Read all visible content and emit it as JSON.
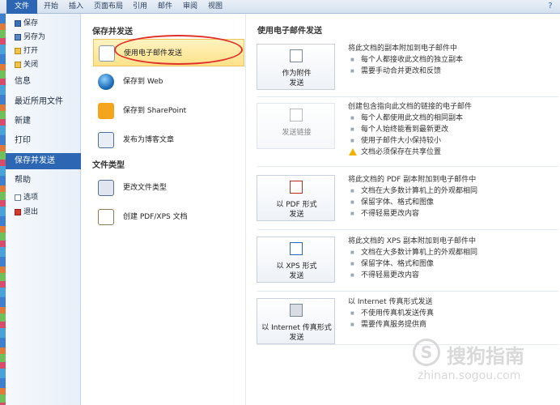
{
  "tabs": [
    "文件",
    "开始",
    "插入",
    "页面布局",
    "引用",
    "邮件",
    "审阅",
    "视图"
  ],
  "window_help": "?",
  "left_menu": {
    "items": [
      {
        "label": "保存",
        "icon": "save-icon"
      },
      {
        "label": "另存为",
        "icon": "save-as-icon"
      },
      {
        "label": "打开",
        "icon": "open-folder-icon"
      },
      {
        "label": "关闭",
        "icon": "close-document-icon"
      }
    ],
    "sections": [
      "信息",
      "最近所用文件",
      "新建",
      "打印",
      "保存并发送",
      "帮助"
    ],
    "active_section": "保存并发送",
    "bottom_items": [
      {
        "label": "选项",
        "icon": "options-icon"
      },
      {
        "label": "退出",
        "icon": "exit-icon"
      }
    ]
  },
  "middle": {
    "section1_title": "保存并发送",
    "options1": [
      {
        "label": "使用电子邮件发送",
        "icon": "email-icon",
        "selected": true
      },
      {
        "label": "保存到 Web",
        "icon": "globe-icon",
        "selected": false
      },
      {
        "label": "保存到 SharePoint",
        "icon": "sharepoint-icon",
        "selected": false
      },
      {
        "label": "发布为博客文章",
        "icon": "blog-icon",
        "selected": false
      }
    ],
    "section2_title": "文件类型",
    "options2": [
      {
        "label": "更改文件类型",
        "icon": "change-filetype-icon"
      },
      {
        "label": "创建 PDF/XPS 文档",
        "icon": "pdf-xps-icon"
      }
    ]
  },
  "right": {
    "title": "使用电子邮件发送",
    "actions": [
      {
        "button": [
          "作为附件",
          "发送"
        ],
        "icon": "attachment-icon",
        "enabled": true,
        "desc_title": "将此文档的副本附加到电子邮件中",
        "bullets": [
          "每个人都接收此文档的独立副本",
          "需要手动合并更改和反馈"
        ],
        "warning": ""
      },
      {
        "button": [
          "发送链接"
        ],
        "icon": "link-icon",
        "enabled": false,
        "desc_title": "创建包含指向此文档的链接的电子邮件",
        "bullets": [
          "每个人都使用此文档的相同副本",
          "每个人始终能看到最新更改",
          "使用子邮件大小保持较小"
        ],
        "warning": "文档必须保存在共享位置"
      },
      {
        "button": [
          "以 PDF 形式",
          "发送"
        ],
        "icon": "pdf-icon",
        "enabled": true,
        "desc_title": "将此文档的 PDF 副本附加到电子邮件中",
        "bullets": [
          "文档在大多数计算机上的外观都相同",
          "保留字体、格式和图像",
          "不得轻易更改内容"
        ],
        "warning": ""
      },
      {
        "button": [
          "以 XPS 形式",
          "发送"
        ],
        "icon": "xps-icon",
        "enabled": true,
        "desc_title": "将此文档的 XPS 副本附加到电子邮件中",
        "bullets": [
          "文档在大多数计算机上的外观都相同",
          "保留字体、格式和图像",
          "不得轻易更改内容"
        ],
        "warning": ""
      },
      {
        "button": [
          "以 Internet 传真形式",
          "发送"
        ],
        "icon": "fax-icon",
        "enabled": true,
        "desc_title": "以 Internet 传真形式发送",
        "bullets": [
          "不使用传真机发送传真",
          "需要传真服务提供商"
        ],
        "warning": ""
      }
    ]
  },
  "watermark": {
    "logo": "S",
    "text": "搜狗指南",
    "url": "zhinan.sogou.com"
  },
  "colors": {
    "file_tab": "#2d66b3",
    "selected_option": "#fde28a",
    "highlight_circle": "#e0302a",
    "warning": "#f0b400"
  }
}
